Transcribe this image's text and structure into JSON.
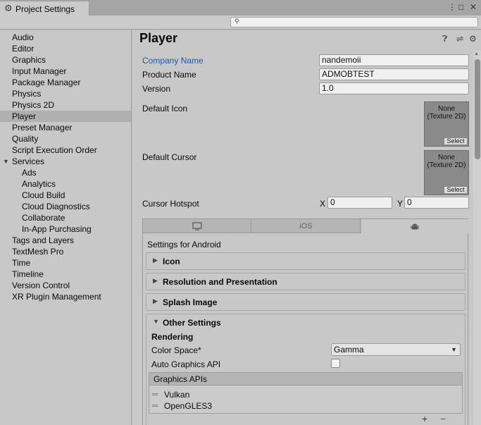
{
  "window": {
    "tab_icon": "gear-icon",
    "tab_title": "Project Settings",
    "menu_icon": "kebab-menu-icon",
    "maximize_icon": "maximize-icon",
    "close_icon": "close-icon"
  },
  "search": {
    "icon": "search-icon",
    "placeholder": ""
  },
  "sidebar": {
    "items": [
      {
        "label": "Audio"
      },
      {
        "label": "Editor"
      },
      {
        "label": "Graphics"
      },
      {
        "label": "Input Manager"
      },
      {
        "label": "Package Manager"
      },
      {
        "label": "Physics"
      },
      {
        "label": "Physics 2D"
      },
      {
        "label": "Player",
        "selected": true
      },
      {
        "label": "Preset Manager"
      },
      {
        "label": "Quality"
      },
      {
        "label": "Script Execution Order"
      },
      {
        "label": "Services",
        "expanded": true
      },
      {
        "label": "Ads"
      },
      {
        "label": "Analytics"
      },
      {
        "label": "Cloud Build"
      },
      {
        "label": "Cloud Diagnostics"
      },
      {
        "label": "Collaborate"
      },
      {
        "label": "In-App Purchasing"
      },
      {
        "label": "Tags and Layers"
      },
      {
        "label": "TextMesh Pro"
      },
      {
        "label": "Time"
      },
      {
        "label": "Timeline"
      },
      {
        "label": "Version Control"
      },
      {
        "label": "XR Plugin Management"
      }
    ]
  },
  "main": {
    "title": "Player",
    "header_icons": [
      "help-icon",
      "sliders-icon",
      "settings-icon"
    ],
    "company_label": "Company Name",
    "company_value": "nandemoii",
    "product_label": "Product Name",
    "product_value": "ADMOBTEST",
    "version_label": "Version",
    "version_value": "1.0",
    "default_icon_label": "Default Icon",
    "default_cursor_label": "Default Cursor",
    "texture_none_line1": "None",
    "texture_none_line2": "(Texture 2D)",
    "select_label": "Select",
    "cursor_hotspot_label": "Cursor Hotspot",
    "hotspot_x_label": "X",
    "hotspot_x_value": "0",
    "hotspot_y_label": "Y",
    "hotspot_y_value": "0",
    "platform_tabs": [
      {
        "name": "standalone",
        "icon": "monitor-icon",
        "label": ""
      },
      {
        "name": "ios",
        "icon": "",
        "label": "iOS"
      },
      {
        "name": "android",
        "icon": "android-icon",
        "label": "",
        "active": true
      }
    ],
    "settings_for": "Settings for Android",
    "sections": [
      {
        "title": "Icon",
        "expanded": false
      },
      {
        "title": "Resolution and Presentation",
        "expanded": false
      },
      {
        "title": "Splash Image",
        "expanded": false
      },
      {
        "title": "Other Settings",
        "expanded": true
      }
    ],
    "other": {
      "rendering_heading": "Rendering",
      "color_space_label": "Color Space*",
      "color_space_value": "Gamma",
      "auto_graphics_label": "Auto Graphics API",
      "auto_graphics_checked": false,
      "graphics_apis_header": "Graphics APIs",
      "graphics_apis": [
        "Vulkan",
        "OpenGLES3"
      ],
      "add_label": "+",
      "remove_label": "−"
    }
  },
  "colors": {
    "accent_label": "#1c5aa8",
    "selected_row": "#b0b0b0",
    "panel_bg": "#c8c8c8"
  }
}
